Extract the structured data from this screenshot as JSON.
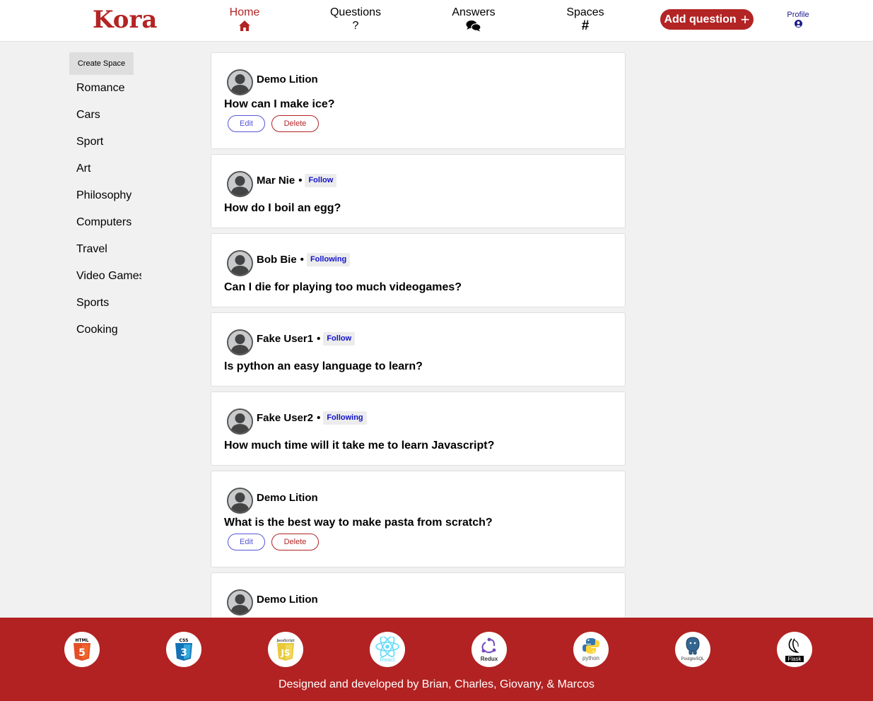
{
  "brand": {
    "logo_text": "Kora",
    "accent_color": "#b32424"
  },
  "nav": {
    "home": {
      "label": "Home",
      "icon": "home-icon"
    },
    "questions": {
      "label": "Questions",
      "icon_text": "?"
    },
    "answers": {
      "label": "Answers",
      "icon": "comments-icon"
    },
    "spaces": {
      "label": "Spaces",
      "icon_text": "#"
    },
    "add_question": {
      "label": "Add question",
      "icon_text": "+"
    },
    "profile": {
      "label": "Profile",
      "icon": "user-circle-icon"
    }
  },
  "sidebar": {
    "create_space_label": "Create Space",
    "spaces": [
      "Romance",
      "Cars",
      "Sport",
      "Art",
      "Philosophy",
      "Computers",
      "Travel",
      "Video Games",
      "Sports",
      "Cooking"
    ]
  },
  "feed": {
    "edit_label": "Edit",
    "delete_label": "Delete",
    "separator": "•",
    "questions": [
      {
        "author": "Demo Lition",
        "follow": "",
        "text": "How can I make ice?",
        "own": true
      },
      {
        "author": "Mar Nie",
        "follow": "Follow",
        "text": "How do I boil an egg?",
        "own": false
      },
      {
        "author": "Bob Bie",
        "follow": "Following",
        "text": "Can I die for playing too much videogames?",
        "own": false
      },
      {
        "author": "Fake User1",
        "follow": "Follow",
        "text": "Is python an easy language to learn?",
        "own": false
      },
      {
        "author": "Fake User2",
        "follow": "Following",
        "text": "How much time will it take me to learn Javascript?",
        "own": false
      },
      {
        "author": "Demo Lition",
        "follow": "",
        "text": "What is the best way to make pasta from scratch?",
        "own": true
      },
      {
        "author": "Demo Lition",
        "follow": "",
        "text": "",
        "own": true
      }
    ]
  },
  "footer": {
    "credits": "Designed and developed by Brian, Charles, Giovany, & Marcos",
    "background_color": "#b22222",
    "technologies": [
      {
        "icon": "html5-icon",
        "caption": "HTML"
      },
      {
        "icon": "css3-icon",
        "caption": "CSS"
      },
      {
        "icon": "javascript-icon",
        "caption": "JavaScript"
      },
      {
        "icon": "react-icon",
        "caption": "React"
      },
      {
        "icon": "redux-icon",
        "caption": "Redux"
      },
      {
        "icon": "python-icon",
        "caption": "python"
      },
      {
        "icon": "postgresql-icon",
        "caption": "PostgreSQL"
      },
      {
        "icon": "flask-icon",
        "caption": "Flask"
      }
    ]
  }
}
